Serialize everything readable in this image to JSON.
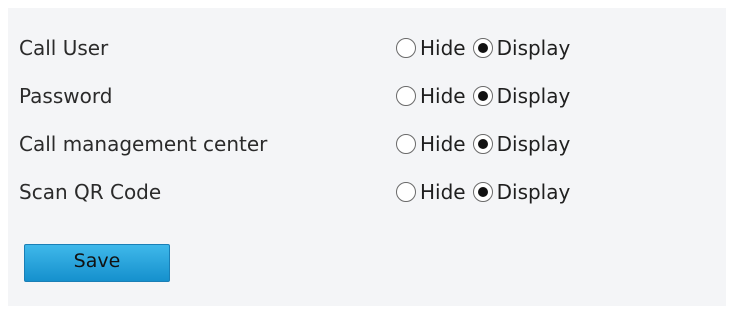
{
  "settings": {
    "rows": [
      {
        "label": "Call User",
        "options": [
          "Hide",
          "Display"
        ],
        "selected": "Display"
      },
      {
        "label": "Password",
        "options": [
          "Hide",
          "Display"
        ],
        "selected": "Display"
      },
      {
        "label": "Call management center",
        "options": [
          "Hide",
          "Display"
        ],
        "selected": "Display"
      },
      {
        "label": "Scan QR Code",
        "options": [
          "Hide",
          "Display"
        ],
        "selected": "Display"
      }
    ]
  },
  "actions": {
    "save_label": "Save"
  },
  "colors": {
    "panel_background": "#f4f5f7",
    "button_top": "#3fb8ea",
    "button_bottom": "#1590cd"
  }
}
